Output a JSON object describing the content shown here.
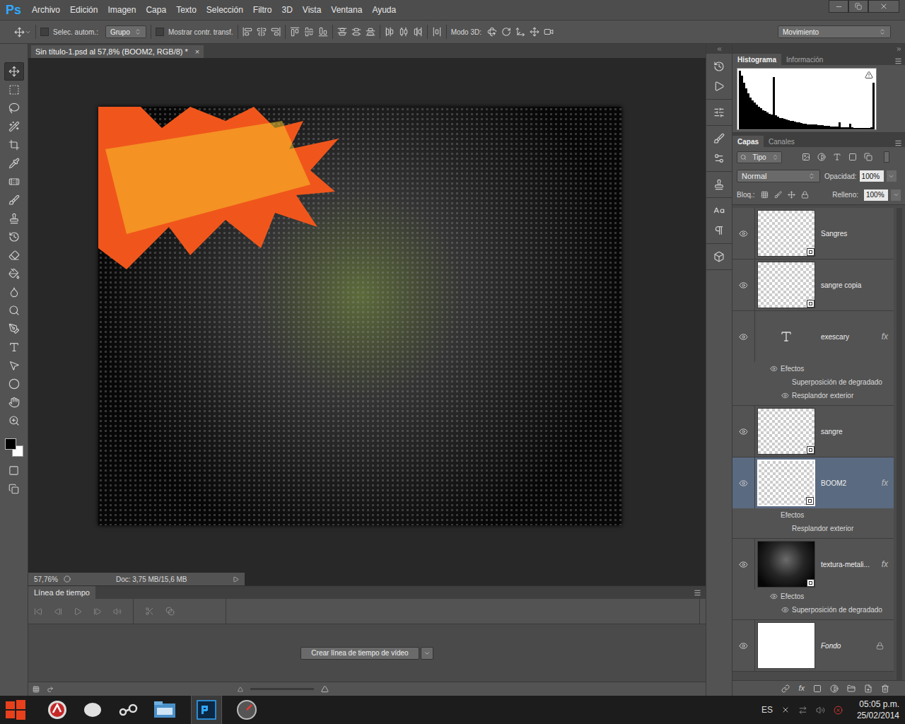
{
  "app": {
    "logo": "Ps"
  },
  "menu": [
    "Archivo",
    "Edición",
    "Imagen",
    "Capa",
    "Texto",
    "Selección",
    "Filtro",
    "3D",
    "Vista",
    "Ventana",
    "Ayuda"
  ],
  "options_bar": {
    "auto_select": {
      "label": "Selec. autom.:",
      "checked": false
    },
    "auto_select_target": "Grupo",
    "show_transform": {
      "label": "Mostrar contr. transf.",
      "checked": false
    },
    "mode_3d_label": "Modo 3D:",
    "workspace": "Movimiento"
  },
  "tools": [
    {
      "selected": true
    },
    {
      "selected": false
    },
    {
      "selected": false
    },
    {
      "selected": false
    },
    {
      "selected": false
    },
    {
      "selected": false
    },
    {
      "selected": false
    },
    {
      "selected": false
    },
    {
      "selected": false
    },
    {
      "selected": false
    },
    {
      "selected": false
    },
    {
      "selected": false
    },
    {
      "selected": false
    },
    {
      "selected": false
    },
    {
      "selected": false
    },
    {
      "selected": false
    },
    {
      "selected": false
    },
    {
      "selected": false
    },
    {
      "selected": false
    },
    {
      "selected": false
    }
  ],
  "colors": {
    "foreground": "#000000",
    "background": "#ffffff"
  },
  "document": {
    "tab": "Sin título-1.psd al 57,8% (BOOM2, RGB/8) *",
    "close": "×"
  },
  "status_bar": {
    "zoom": "57,76%",
    "doc_info": "Doc: 3,75 MB/15,6 MB"
  },
  "timeline": {
    "title": "Línea de tiempo",
    "create_button": "Crear línea de tiempo de vídeo"
  },
  "histogram_panel": {
    "tabs": [
      {
        "label": "Histograma",
        "selected": true
      },
      {
        "label": "Información",
        "selected": false
      }
    ],
    "values": [
      100,
      92,
      80,
      70,
      62,
      55,
      50,
      46,
      42,
      39,
      36,
      33,
      31,
      29,
      27,
      25,
      90,
      24,
      22,
      20,
      19,
      18,
      17,
      16,
      15,
      14,
      13,
      12,
      12,
      11,
      10,
      10,
      9,
      9,
      8,
      8,
      8,
      7,
      7,
      7,
      6,
      6,
      6,
      5,
      5,
      5,
      5,
      12,
      4,
      4,
      4,
      4,
      10,
      4,
      3,
      3,
      3,
      3,
      3,
      3,
      3,
      3,
      4,
      80
    ]
  },
  "layers_panel": {
    "tabs": [
      {
        "label": "Capas",
        "selected": true
      },
      {
        "label": "Canales",
        "selected": false
      }
    ],
    "filter": "Tipo",
    "blend_mode": "Normal",
    "opacity_label": "Opacidad:",
    "opacity": "100%",
    "lock_label": "Bloq.:",
    "fill_label": "Relleno:",
    "fill": "100%",
    "fx_label": "fx",
    "layers": [
      {
        "name": "Sangres",
        "kind": "smart",
        "visible": true,
        "selected": false,
        "has_fx": false,
        "effects": null
      },
      {
        "name": "sangre copia",
        "kind": "smart",
        "visible": true,
        "selected": false,
        "has_fx": false,
        "effects": null
      },
      {
        "name": "exescary",
        "kind": "text",
        "visible": true,
        "selected": false,
        "has_fx": true,
        "effects": {
          "title": "Efectos",
          "visible": true,
          "items": [
            {
              "name": "Superposición de degradado",
              "visible": false
            },
            {
              "name": "Resplandor exterior",
              "visible": true
            }
          ]
        }
      },
      {
        "name": "sangre",
        "kind": "smart",
        "visible": true,
        "selected": false,
        "has_fx": false,
        "effects": null
      },
      {
        "name": "BOOM2",
        "kind": "smart",
        "visible": true,
        "selected": true,
        "has_fx": true,
        "effects": {
          "title": "Efectos",
          "visible": false,
          "items": [
            {
              "name": "Resplandor exterior",
              "visible": false
            }
          ]
        }
      },
      {
        "name": "textura-metali...",
        "kind": "texture",
        "visible": true,
        "selected": false,
        "has_fx": true,
        "effects": {
          "title": "Efectos",
          "visible": true,
          "items": [
            {
              "name": "Superposición de degradado",
              "visible": true
            }
          ]
        }
      },
      {
        "name": "Fondo",
        "kind": "background",
        "visible": true,
        "selected": false,
        "has_fx": false,
        "effects": null
      }
    ]
  },
  "taskbar": {
    "language": "ES",
    "time": "05:05 p.m.",
    "date": "25/02/2014"
  }
}
